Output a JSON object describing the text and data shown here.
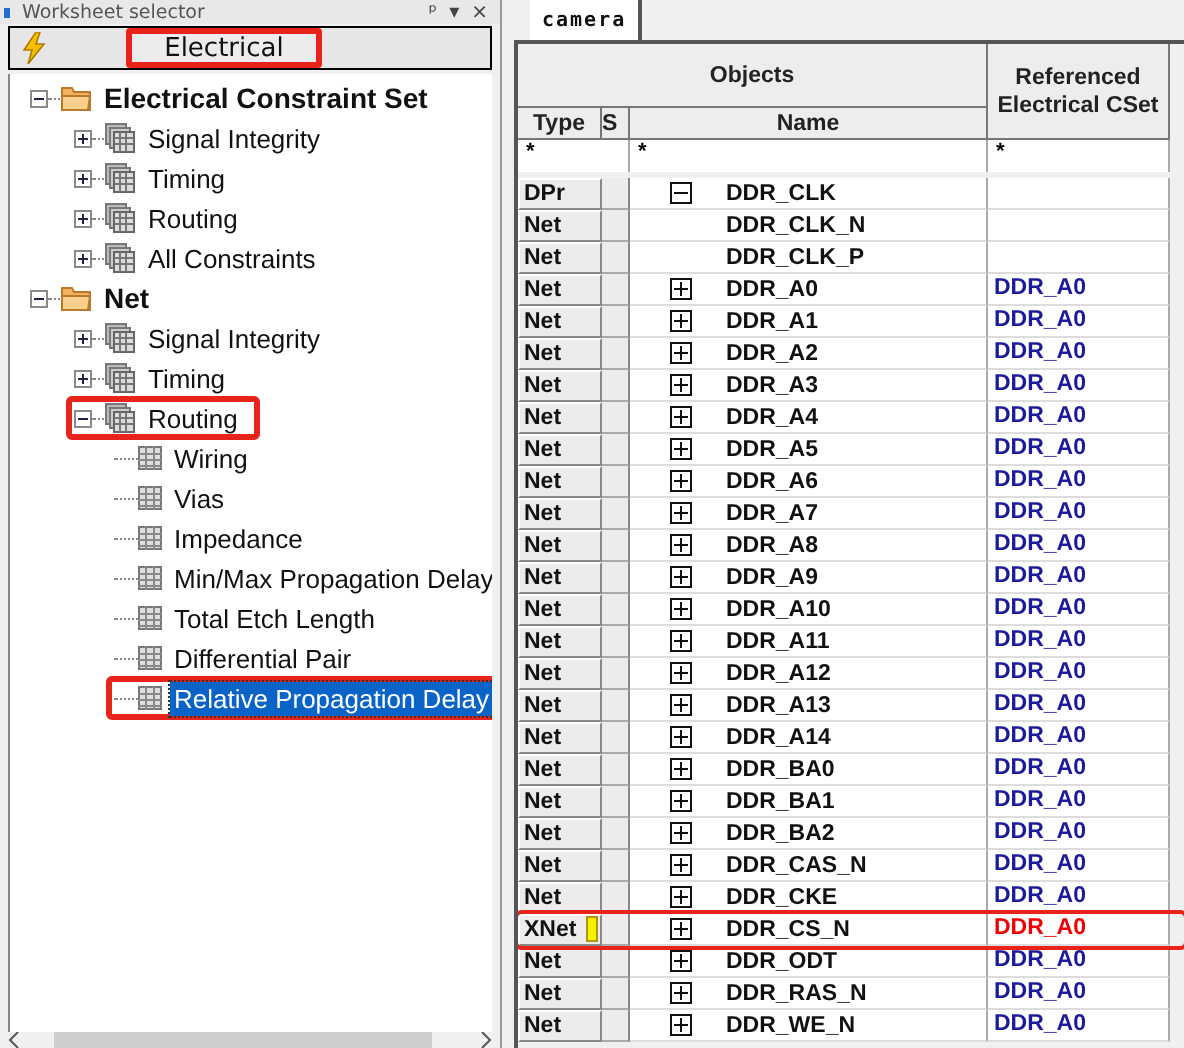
{
  "panel": {
    "title": "Worksheet selector",
    "pin": "ᵖ",
    "menu": "▾",
    "close": "×"
  },
  "domain_button": {
    "label": "Electrical",
    "highlighted": true
  },
  "tree": [
    {
      "label": "Electrical Constraint Set",
      "kind": "folder",
      "expanded": true,
      "selected": false,
      "highlighted": false,
      "children": [
        {
          "label": "Signal Integrity",
          "kind": "stack",
          "expanded": false,
          "selected": false,
          "highlighted": false
        },
        {
          "label": "Timing",
          "kind": "stack",
          "expanded": false,
          "selected": false,
          "highlighted": false
        },
        {
          "label": "Routing",
          "kind": "stack",
          "expanded": false,
          "selected": false,
          "highlighted": false
        },
        {
          "label": "All Constraints",
          "kind": "stack",
          "expanded": false,
          "selected": false,
          "highlighted": false
        }
      ]
    },
    {
      "label": "Net",
      "kind": "folder",
      "expanded": true,
      "selected": false,
      "highlighted": false,
      "children": [
        {
          "label": "Signal Integrity",
          "kind": "stack",
          "expanded": false,
          "selected": false,
          "highlighted": false
        },
        {
          "label": "Timing",
          "kind": "stack",
          "expanded": false,
          "selected": false,
          "highlighted": false
        },
        {
          "label": "Routing",
          "kind": "stack",
          "expanded": true,
          "selected": false,
          "highlighted": true,
          "children": [
            {
              "label": "Wiring",
              "kind": "sheet",
              "selected": false,
              "highlighted": false
            },
            {
              "label": "Vias",
              "kind": "sheet",
              "selected": false,
              "highlighted": false
            },
            {
              "label": "Impedance",
              "kind": "sheet",
              "selected": false,
              "highlighted": false
            },
            {
              "label": "Min/Max Propagation Delay",
              "kind": "sheet",
              "selected": false,
              "highlighted": false
            },
            {
              "label": "Total Etch Length",
              "kind": "sheet",
              "selected": false,
              "highlighted": false
            },
            {
              "label": "Differential Pair",
              "kind": "sheet",
              "selected": false,
              "highlighted": false
            },
            {
              "label": "Relative Propagation Delay",
              "kind": "sheet",
              "selected": true,
              "highlighted": true
            }
          ]
        }
      ]
    }
  ],
  "tabs": [
    {
      "label": "camera",
      "selected": true
    }
  ],
  "table": {
    "group_header": "Objects",
    "ref_header": "Referenced Electrical CSet",
    "columns": [
      "Type",
      "S",
      "Name"
    ],
    "filters": [
      "*",
      "*",
      "*"
    ],
    "rows": [
      {
        "type": "DPr",
        "name": "DDR_CLK",
        "kind": "pair",
        "expanded": true,
        "flagged": false,
        "highlighted": false
      },
      {
        "type": "Net",
        "name": "DDR_CLK_N",
        "kind": "member",
        "flagged": false,
        "highlighted": false
      },
      {
        "type": "Net",
        "name": "DDR_CLK_P",
        "kind": "member",
        "flagged": false,
        "highlighted": false
      },
      {
        "type": "Net",
        "name": "DDR_A0",
        "kind": "net",
        "expanded": false,
        "ref": "DDR_A0",
        "flagged": false,
        "mismatch": false,
        "highlighted": false
      },
      {
        "type": "Net",
        "name": "DDR_A1",
        "kind": "net",
        "expanded": false,
        "ref": "DDR_A0",
        "flagged": false,
        "mismatch": false,
        "highlighted": false
      },
      {
        "type": "Net",
        "name": "DDR_A2",
        "kind": "net",
        "expanded": false,
        "ref": "DDR_A0",
        "flagged": false,
        "mismatch": false,
        "highlighted": false
      },
      {
        "type": "Net",
        "name": "DDR_A3",
        "kind": "net",
        "expanded": false,
        "ref": "DDR_A0",
        "flagged": false,
        "mismatch": false,
        "highlighted": false
      },
      {
        "type": "Net",
        "name": "DDR_A4",
        "kind": "net",
        "expanded": false,
        "ref": "DDR_A0",
        "flagged": false,
        "mismatch": false,
        "highlighted": false
      },
      {
        "type": "Net",
        "name": "DDR_A5",
        "kind": "net",
        "expanded": false,
        "ref": "DDR_A0",
        "flagged": false,
        "mismatch": false,
        "highlighted": false
      },
      {
        "type": "Net",
        "name": "DDR_A6",
        "kind": "net",
        "expanded": false,
        "ref": "DDR_A0",
        "flagged": false,
        "mismatch": false,
        "highlighted": false
      },
      {
        "type": "Net",
        "name": "DDR_A7",
        "kind": "net",
        "expanded": false,
        "ref": "DDR_A0",
        "flagged": false,
        "mismatch": false,
        "highlighted": false
      },
      {
        "type": "Net",
        "name": "DDR_A8",
        "kind": "net",
        "expanded": false,
        "ref": "DDR_A0",
        "flagged": false,
        "mismatch": false,
        "highlighted": false
      },
      {
        "type": "Net",
        "name": "DDR_A9",
        "kind": "net",
        "expanded": false,
        "ref": "DDR_A0",
        "flagged": false,
        "mismatch": false,
        "highlighted": false
      },
      {
        "type": "Net",
        "name": "DDR_A10",
        "kind": "net",
        "expanded": false,
        "ref": "DDR_A0",
        "flagged": false,
        "mismatch": false,
        "highlighted": false
      },
      {
        "type": "Net",
        "name": "DDR_A11",
        "kind": "net",
        "expanded": false,
        "ref": "DDR_A0",
        "flagged": false,
        "mismatch": false,
        "highlighted": false
      },
      {
        "type": "Net",
        "name": "DDR_A12",
        "kind": "net",
        "expanded": false,
        "ref": "DDR_A0",
        "flagged": false,
        "mismatch": false,
        "highlighted": false
      },
      {
        "type": "Net",
        "name": "DDR_A13",
        "kind": "net",
        "expanded": false,
        "ref": "DDR_A0",
        "flagged": false,
        "mismatch": false,
        "highlighted": false
      },
      {
        "type": "Net",
        "name": "DDR_A14",
        "kind": "net",
        "expanded": false,
        "ref": "DDR_A0",
        "flagged": false,
        "mismatch": false,
        "highlighted": false
      },
      {
        "type": "Net",
        "name": "DDR_BA0",
        "kind": "net",
        "expanded": false,
        "ref": "DDR_A0",
        "flagged": false,
        "mismatch": false,
        "highlighted": false
      },
      {
        "type": "Net",
        "name": "DDR_BA1",
        "kind": "net",
        "expanded": false,
        "ref": "DDR_A0",
        "flagged": false,
        "mismatch": false,
        "highlighted": false
      },
      {
        "type": "Net",
        "name": "DDR_BA2",
        "kind": "net",
        "expanded": false,
        "ref": "DDR_A0",
        "flagged": false,
        "mismatch": false,
        "highlighted": false
      },
      {
        "type": "Net",
        "name": "DDR_CAS_N",
        "kind": "net",
        "expanded": false,
        "ref": "DDR_A0",
        "flagged": false,
        "mismatch": false,
        "highlighted": false
      },
      {
        "type": "Net",
        "name": "DDR_CKE",
        "kind": "net",
        "expanded": false,
        "ref": "DDR_A0",
        "flagged": false,
        "mismatch": false,
        "highlighted": false
      },
      {
        "type": "XNet",
        "name": "DDR_CS_N",
        "kind": "net",
        "expanded": false,
        "ref": "DDR_A0",
        "flagged": true,
        "mismatch": true,
        "highlighted": true
      },
      {
        "type": "Net",
        "name": "DDR_ODT",
        "kind": "net",
        "expanded": false,
        "ref": "DDR_A0",
        "flagged": false,
        "mismatch": false,
        "highlighted": false
      },
      {
        "type": "Net",
        "name": "DDR_RAS_N",
        "kind": "net",
        "expanded": false,
        "ref": "DDR_A0",
        "flagged": false,
        "mismatch": false,
        "highlighted": false
      },
      {
        "type": "Net",
        "name": "DDR_WE_N",
        "kind": "net",
        "expanded": false,
        "ref": "DDR_A0",
        "flagged": false,
        "mismatch": false,
        "highlighted": false
      }
    ]
  }
}
